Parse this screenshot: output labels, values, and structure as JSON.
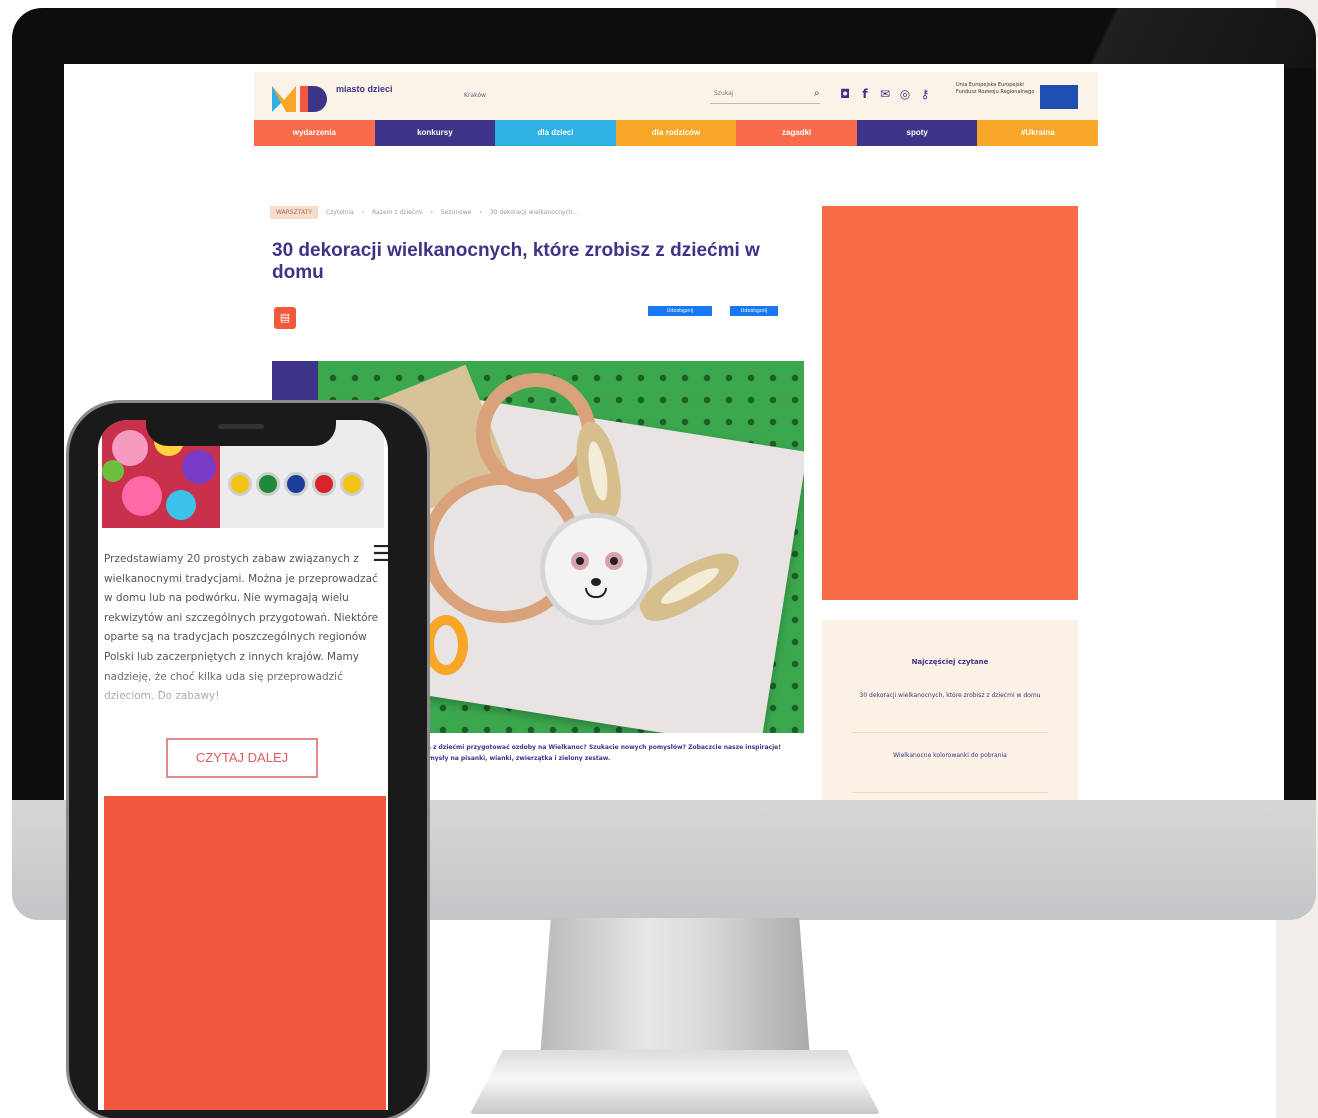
{
  "site": {
    "logo_text": "miasto dzieci",
    "location": "Kraków",
    "search_placeholder": "Szukaj",
    "eu_text": "Unia Europejska Europejski Fundusz Rozwoju Regionalnego",
    "social_icons": [
      "instagram-icon",
      "facebook-icon",
      "mail-icon",
      "location-icon",
      "key-icon"
    ]
  },
  "nav": [
    {
      "label": "wydarzenia",
      "color": "#f76b4b"
    },
    {
      "label": "konkursy",
      "color": "#3c3488"
    },
    {
      "label": "dla dzieci",
      "color": "#2fb1e6"
    },
    {
      "label": "dla rodziców",
      "color": "#f7a628"
    },
    {
      "label": "zagadki",
      "color": "#f76b4b"
    },
    {
      "label": "spoty",
      "color": "#3c3488"
    },
    {
      "label": "#Ukraina",
      "color": "#f7a628"
    }
  ],
  "article": {
    "tag": "WARSZTATY",
    "breadcrumbs": [
      "Czytelnia",
      "Razem z dziećmi",
      "Sezonowe",
      "30 dekoracji wielkanocnych..."
    ],
    "title": "30 dekoracji wielkanocnych, które zrobisz z dziećmi w domu",
    "share_facebook": "Udostępnij",
    "share_second": "Udostępnij",
    "lead": "...a z dziećmi przygotować ozdoby na Wielkanoc? Szukacie nowych pomysłów? Zobaczcie nasze inspiracje! Pomysły na pisanki, wianki, zwierzątka i zielony zestaw."
  },
  "sidebar": {
    "most_read_heading": "Najczęściej czytane",
    "most_read": [
      "30 dekoracji wielkanocnych, które zrobisz z dziećmi w domu",
      "Wielkanocne kolorowanki do pobrania"
    ]
  },
  "phone": {
    "intro": "Przedstawiamy 20 prostych zabaw związanych z wielkanocnymi tradycjami. Można je przeprowadzać w domu lub na podwórku. Nie wymagają wielu rekwizytów ani szczególnych przygotowań. Niektóre oparte są na tradycjach poszczególnych regionów Polski lub zaczerpniętych z innych krajów. Mamy nadzieję, że choć kilka uda się przeprowadzić dzieciom. Do zabawy!",
    "read_more": "CZYTAJ DALEJ",
    "paint_colors": [
      "#f2c314",
      "#1e8a3a",
      "#1d3e9a",
      "#d8232a",
      "#f2c314"
    ]
  }
}
